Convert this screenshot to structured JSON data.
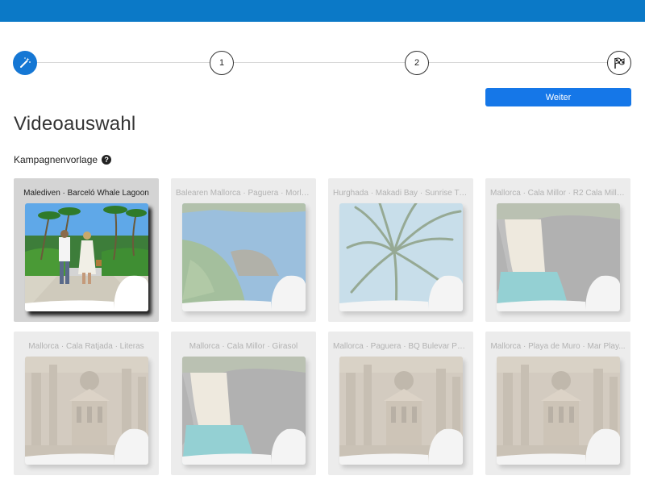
{
  "stepper": {
    "steps": [
      {
        "kind": "wand-icon",
        "label": "",
        "active": true
      },
      {
        "kind": "number",
        "label": "1",
        "active": false
      },
      {
        "kind": "number",
        "label": "2",
        "active": false
      },
      {
        "kind": "flag-icon",
        "label": "",
        "active": false
      }
    ]
  },
  "actions": {
    "next_label": "Weiter"
  },
  "page": {
    "title": "Videoauswahl"
  },
  "section": {
    "label": "Kampagnenvorlage",
    "help": "?"
  },
  "cards": [
    {
      "title": "Malediven · Barceló Whale Lagoon",
      "scene": "beach-couple",
      "selected": true
    },
    {
      "title": "Balearen Mallorca · Paguera · Morla...",
      "scene": "lagoon",
      "selected": false
    },
    {
      "title": "Hurghada · Makadi Bay · Sunrise Tu...",
      "scene": "palm",
      "selected": false
    },
    {
      "title": "Mallorca · Cala Millor · R2 Cala Millo...",
      "scene": "cove",
      "selected": false
    },
    {
      "title": "Mallorca · Cala Ratjada · Literas",
      "scene": "cathedral",
      "selected": false
    },
    {
      "title": "Mallorca · Cala Millor · Girasol",
      "scene": "cove",
      "selected": false
    },
    {
      "title": "Mallorca · Paguera · BQ Bulevar Pag...",
      "scene": "cathedral",
      "selected": false
    },
    {
      "title": "Mallorca · Playa de Muro · Mar Play...",
      "scene": "cathedral",
      "selected": false
    }
  ],
  "colors": {
    "topbar": "#0b79c7",
    "accent": "#1577e8",
    "card_bg": "#ececec",
    "card_selected_bg": "#d4d4d4"
  }
}
